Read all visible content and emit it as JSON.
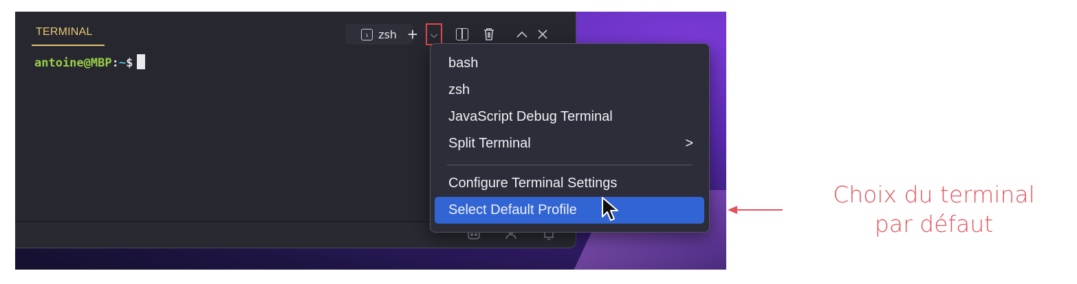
{
  "panel": {
    "tab_title": "TERMINAL",
    "shell_name": "zsh",
    "icons": {
      "shell": "terminal-prompt-icon",
      "plus": "add-terminal-icon",
      "chevron": "chevron-down-icon",
      "split": "split-terminal-icon",
      "trash": "trash-icon",
      "maximize": "chevron-up-icon",
      "close": "close-icon"
    }
  },
  "terminal": {
    "user": "antoine@MBP",
    "colon": ":",
    "path": "~",
    "dollar": "$"
  },
  "menu": {
    "items": [
      {
        "label": "bash"
      },
      {
        "label": "zsh"
      },
      {
        "label": "JavaScript Debug Terminal"
      },
      {
        "label": "Split Terminal",
        "arrow": ">"
      },
      {
        "label": "Configure Terminal Settings"
      },
      {
        "label": "Select Default Profile"
      }
    ]
  },
  "annotation": {
    "line1": "Choix du terminal",
    "line2": "par défaut",
    "color": "#e4535b"
  },
  "colors": {
    "accent": "#e8c872",
    "highlight": "#3165d3",
    "prompt_user": "#9bcf46",
    "prompt_path": "#4ec0d6"
  }
}
